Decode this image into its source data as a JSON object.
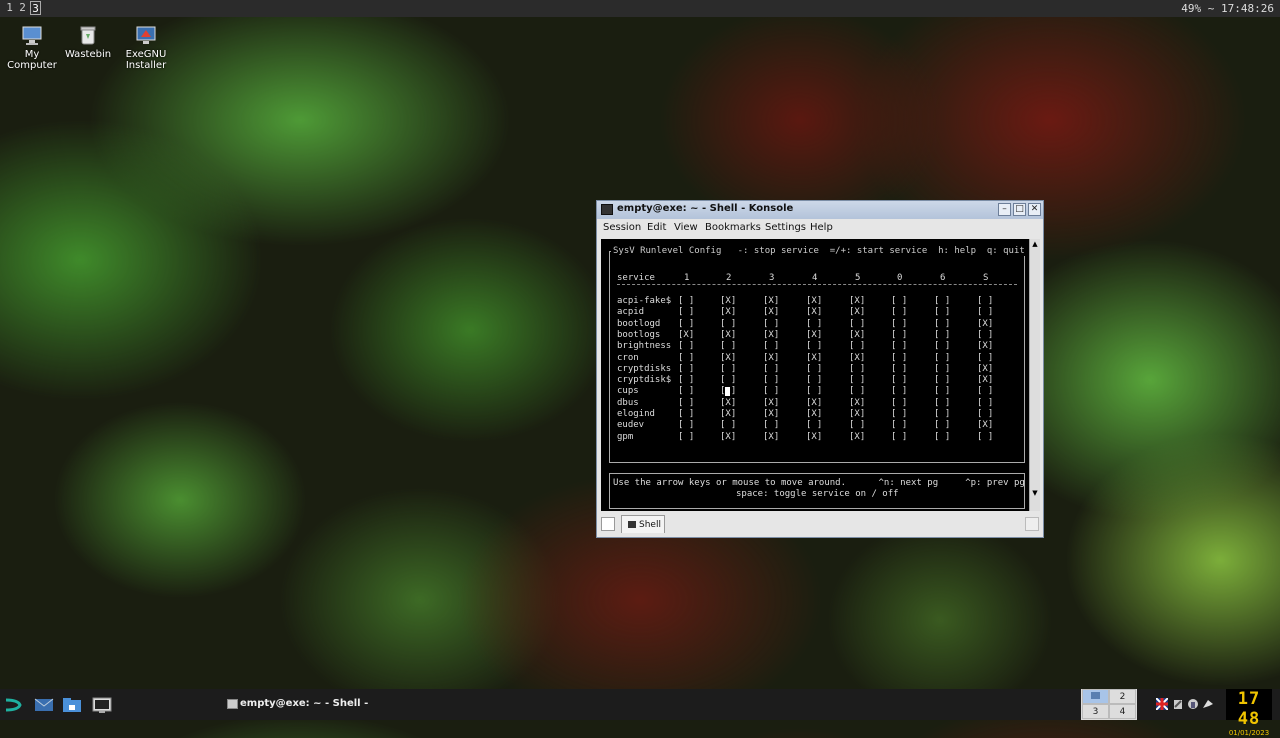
{
  "top_panel": {
    "workspaces": [
      "1",
      "2",
      "3"
    ],
    "active_workspace": "3",
    "status": "49% ~ 17:48:26"
  },
  "desktop_icons": [
    {
      "label_line1": "My",
      "label_line2": "Computer",
      "icon": "computer-icon"
    },
    {
      "label_line1": "Wastebin",
      "label_line2": "",
      "icon": "trash-icon"
    },
    {
      "label_line1": "ExeGNU",
      "label_line2": "Installer",
      "icon": "installer-icon"
    }
  ],
  "window": {
    "title": "empty@exe: ~ - Shell - Konsole",
    "menu": [
      "Session",
      "Edit",
      "View",
      "Bookmarks",
      "Settings",
      "Help"
    ],
    "tab_label": "Shell"
  },
  "terminal": {
    "header": "SysV Runlevel Config   -: stop service  =/+: start service  h: help  q: quit",
    "columns": [
      "service",
      "1",
      "2",
      "3",
      "4",
      "5",
      "0",
      "6",
      "S"
    ],
    "rows": [
      {
        "name": "acpi-fake$",
        "states": [
          "[ ]",
          "[X]",
          "[X]",
          "[X]",
          "[X]",
          "[ ]",
          "[ ]",
          "[ ]"
        ]
      },
      {
        "name": "acpid",
        "states": [
          "[ ]",
          "[X]",
          "[X]",
          "[X]",
          "[X]",
          "[ ]",
          "[ ]",
          "[ ]"
        ]
      },
      {
        "name": "bootlogd",
        "states": [
          "[ ]",
          "[ ]",
          "[ ]",
          "[ ]",
          "[ ]",
          "[ ]",
          "[ ]",
          "[X]"
        ]
      },
      {
        "name": "bootlogs",
        "states": [
          "[X]",
          "[X]",
          "[X]",
          "[X]",
          "[X]",
          "[ ]",
          "[ ]",
          "[ ]"
        ]
      },
      {
        "name": "brightness",
        "states": [
          "[ ]",
          "[ ]",
          "[ ]",
          "[ ]",
          "[ ]",
          "[ ]",
          "[ ]",
          "[X]"
        ]
      },
      {
        "name": "cron",
        "states": [
          "[ ]",
          "[X]",
          "[X]",
          "[X]",
          "[X]",
          "[ ]",
          "[ ]",
          "[ ]"
        ]
      },
      {
        "name": "cryptdisks",
        "states": [
          "[ ]",
          "[ ]",
          "[ ]",
          "[ ]",
          "[ ]",
          "[ ]",
          "[ ]",
          "[X]"
        ]
      },
      {
        "name": "cryptdisk$",
        "states": [
          "[ ]",
          "[ ]",
          "[ ]",
          "[ ]",
          "[ ]",
          "[ ]",
          "[ ]",
          "[X]"
        ]
      },
      {
        "name": "cups",
        "states": [
          "[ ]",
          "[ ]",
          "[ ]",
          "[ ]",
          "[ ]",
          "[ ]",
          "[ ]",
          "[ ]"
        ]
      },
      {
        "name": "dbus",
        "states": [
          "[ ]",
          "[X]",
          "[X]",
          "[X]",
          "[X]",
          "[ ]",
          "[ ]",
          "[ ]"
        ]
      },
      {
        "name": "elogind",
        "states": [
          "[ ]",
          "[X]",
          "[X]",
          "[X]",
          "[X]",
          "[ ]",
          "[ ]",
          "[ ]"
        ]
      },
      {
        "name": "eudev",
        "states": [
          "[ ]",
          "[ ]",
          "[ ]",
          "[ ]",
          "[ ]",
          "[ ]",
          "[ ]",
          "[X]"
        ]
      },
      {
        "name": "gpm",
        "states": [
          "[ ]",
          "[X]",
          "[X]",
          "[X]",
          "[X]",
          "[ ]",
          "[ ]",
          "[ ]"
        ]
      }
    ],
    "footer_line1": "Use the arrow keys or mouse to move around.      ^n: next pg     ^p: prev pg",
    "footer_line2": "space: toggle service on / off"
  },
  "bottom_panel": {
    "task_label": "empty@exe: ~ - Shell -",
    "pager": [
      "1",
      "2",
      "3",
      "4"
    ],
    "clock_time": "17 48",
    "clock_date": "01/01/2023"
  }
}
